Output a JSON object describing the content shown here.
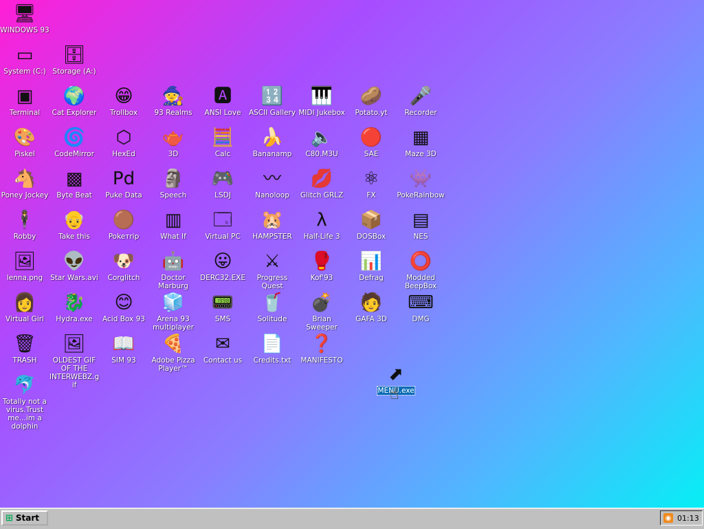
{
  "desktop": {
    "icons": {
      "windows93": {
        "label": "WINDOWS 93",
        "glyph": "🖥"
      },
      "system": {
        "label": "System (C:)",
        "glyph": "▭"
      },
      "storage": {
        "label": "Storage (A:)",
        "glyph": "🗄"
      },
      "terminal": {
        "label": "Terminal",
        "glyph": "▣"
      },
      "cat_explorer": {
        "label": "Cat Explorer",
        "glyph": "🌍"
      },
      "trollbox": {
        "label": "Trollbox",
        "glyph": "😁"
      },
      "realms": {
        "label": "93 Realms",
        "glyph": "🧙"
      },
      "ansi_love": {
        "label": "ANSI Love",
        "glyph": "🅰"
      },
      "ascii_gallery": {
        "label": "ASCII Gallery",
        "glyph": "🔢"
      },
      "midi_jukebox": {
        "label": "MIDI Jukebox",
        "glyph": "🎹"
      },
      "potato": {
        "label": "Potato.yt",
        "glyph": "🥔"
      },
      "recorder": {
        "label": "Recorder",
        "glyph": "🎤"
      },
      "piskel": {
        "label": "Piskel",
        "glyph": "🎨"
      },
      "codemirror": {
        "label": "CodeMirror",
        "glyph": "🌀"
      },
      "hexed": {
        "label": "HexEd",
        "glyph": "⬡"
      },
      "three_d": {
        "label": "3D",
        "glyph": "🫖"
      },
      "calc": {
        "label": "Calc",
        "glyph": "🧮"
      },
      "bananamp": {
        "label": "Bananamp",
        "glyph": "🍌"
      },
      "c80": {
        "label": "C80.M3U",
        "glyph": "🔈"
      },
      "sae": {
        "label": "SAE",
        "glyph": "🔴"
      },
      "maze": {
        "label": "Maze 3D",
        "glyph": "▦"
      },
      "poney": {
        "label": "Poney Jockey",
        "glyph": "🐴"
      },
      "bytebeat": {
        "label": "Byte Beat",
        "glyph": "▩"
      },
      "puredata": {
        "label": "Puke Data",
        "glyph": "Pd"
      },
      "speech": {
        "label": "Speech",
        "glyph": "🗿"
      },
      "lsdj": {
        "label": "LSDJ",
        "glyph": "🎮"
      },
      "nanoloop": {
        "label": "Nanoloop",
        "glyph": "〰"
      },
      "glitch": {
        "label": "Glitch GRLZ",
        "glyph": "💋"
      },
      "fx": {
        "label": "FX",
        "glyph": "⚛"
      },
      "pokerainbow": {
        "label": "PokeRainbow",
        "glyph": "👾"
      },
      "robby": {
        "label": "Robby",
        "glyph": "🕴"
      },
      "takethis": {
        "label": "Take this",
        "glyph": "👴"
      },
      "poketrip": {
        "label": "Pokeтrip",
        "glyph": "🟤"
      },
      "whatif": {
        "label": "What If",
        "glyph": "▥"
      },
      "virtualpc": {
        "label": "Virtual PC",
        "glyph": "🗔"
      },
      "hampster": {
        "label": "HAMPSTER",
        "glyph": "🐹"
      },
      "halflife": {
        "label": "Half-Life 3",
        "glyph": "λ"
      },
      "dosbox": {
        "label": "DOSBox",
        "glyph": "📦"
      },
      "nes": {
        "label": "NES",
        "glyph": "▤"
      },
      "lenna": {
        "label": "lenna.png",
        "glyph": "🖼"
      },
      "starwars": {
        "label": "Star Wars.avi",
        "glyph": "👽"
      },
      "corglitch": {
        "label": "Corglitch",
        "glyph": "🐶"
      },
      "doctor": {
        "label": "Doctor Marburg",
        "glyph": "🤖"
      },
      "derc": {
        "label": "DERC32.EXE",
        "glyph": "😛"
      },
      "progress": {
        "label": "Progress Quest",
        "glyph": "⚔"
      },
      "kof": {
        "label": "Kof'93",
        "glyph": "🥊"
      },
      "defrag": {
        "label": "Defrag",
        "glyph": "📊"
      },
      "beepbox": {
        "label": "Modded BeepBox",
        "glyph": "⭕"
      },
      "virtualgirl": {
        "label": "Virtual Girl",
        "glyph": "👩"
      },
      "hydra": {
        "label": "Hydra.exe",
        "glyph": "🐉"
      },
      "acidbox": {
        "label": "Acid Box 93",
        "glyph": "😊"
      },
      "arena": {
        "label": "Arena 93 multiplayer",
        "glyph": "🧊"
      },
      "sms": {
        "label": "SMS",
        "glyph": "📟"
      },
      "solitude": {
        "label": "Solitude",
        "glyph": "🥤"
      },
      "brian": {
        "label": "Brian Sweeper",
        "glyph": "💣"
      },
      "gafa": {
        "label": "GAFA 3D",
        "glyph": "🧑"
      },
      "dmg": {
        "label": "DMG",
        "glyph": "⌨"
      },
      "trash": {
        "label": "TRASH",
        "glyph": "🗑"
      },
      "oldest": {
        "label": "OLDEST GIF OF THE INTERWEBZ.gif",
        "glyph": "🖼"
      },
      "sim": {
        "label": "SIM 93",
        "glyph": "📖"
      },
      "pizza": {
        "label": "Adobe Pizza Player™",
        "glyph": "🍕"
      },
      "contact": {
        "label": "Contact us",
        "glyph": "✉"
      },
      "credits": {
        "label": "Credits.txt",
        "glyph": "📄"
      },
      "manifesto": {
        "label": "MANIFESTO",
        "glyph": "❓"
      },
      "dolphin": {
        "label": "Totally not a virus.Trust me...im a dolphin",
        "glyph": "🐬"
      },
      "menu": {
        "label": "MENU.exe",
        "glyph": "⬈"
      }
    }
  },
  "taskbar": {
    "start_label": "Start",
    "start_glyph": "⊞",
    "tray_glyph": "◉",
    "clock": "01:13"
  },
  "cursor_glyph": "☝"
}
